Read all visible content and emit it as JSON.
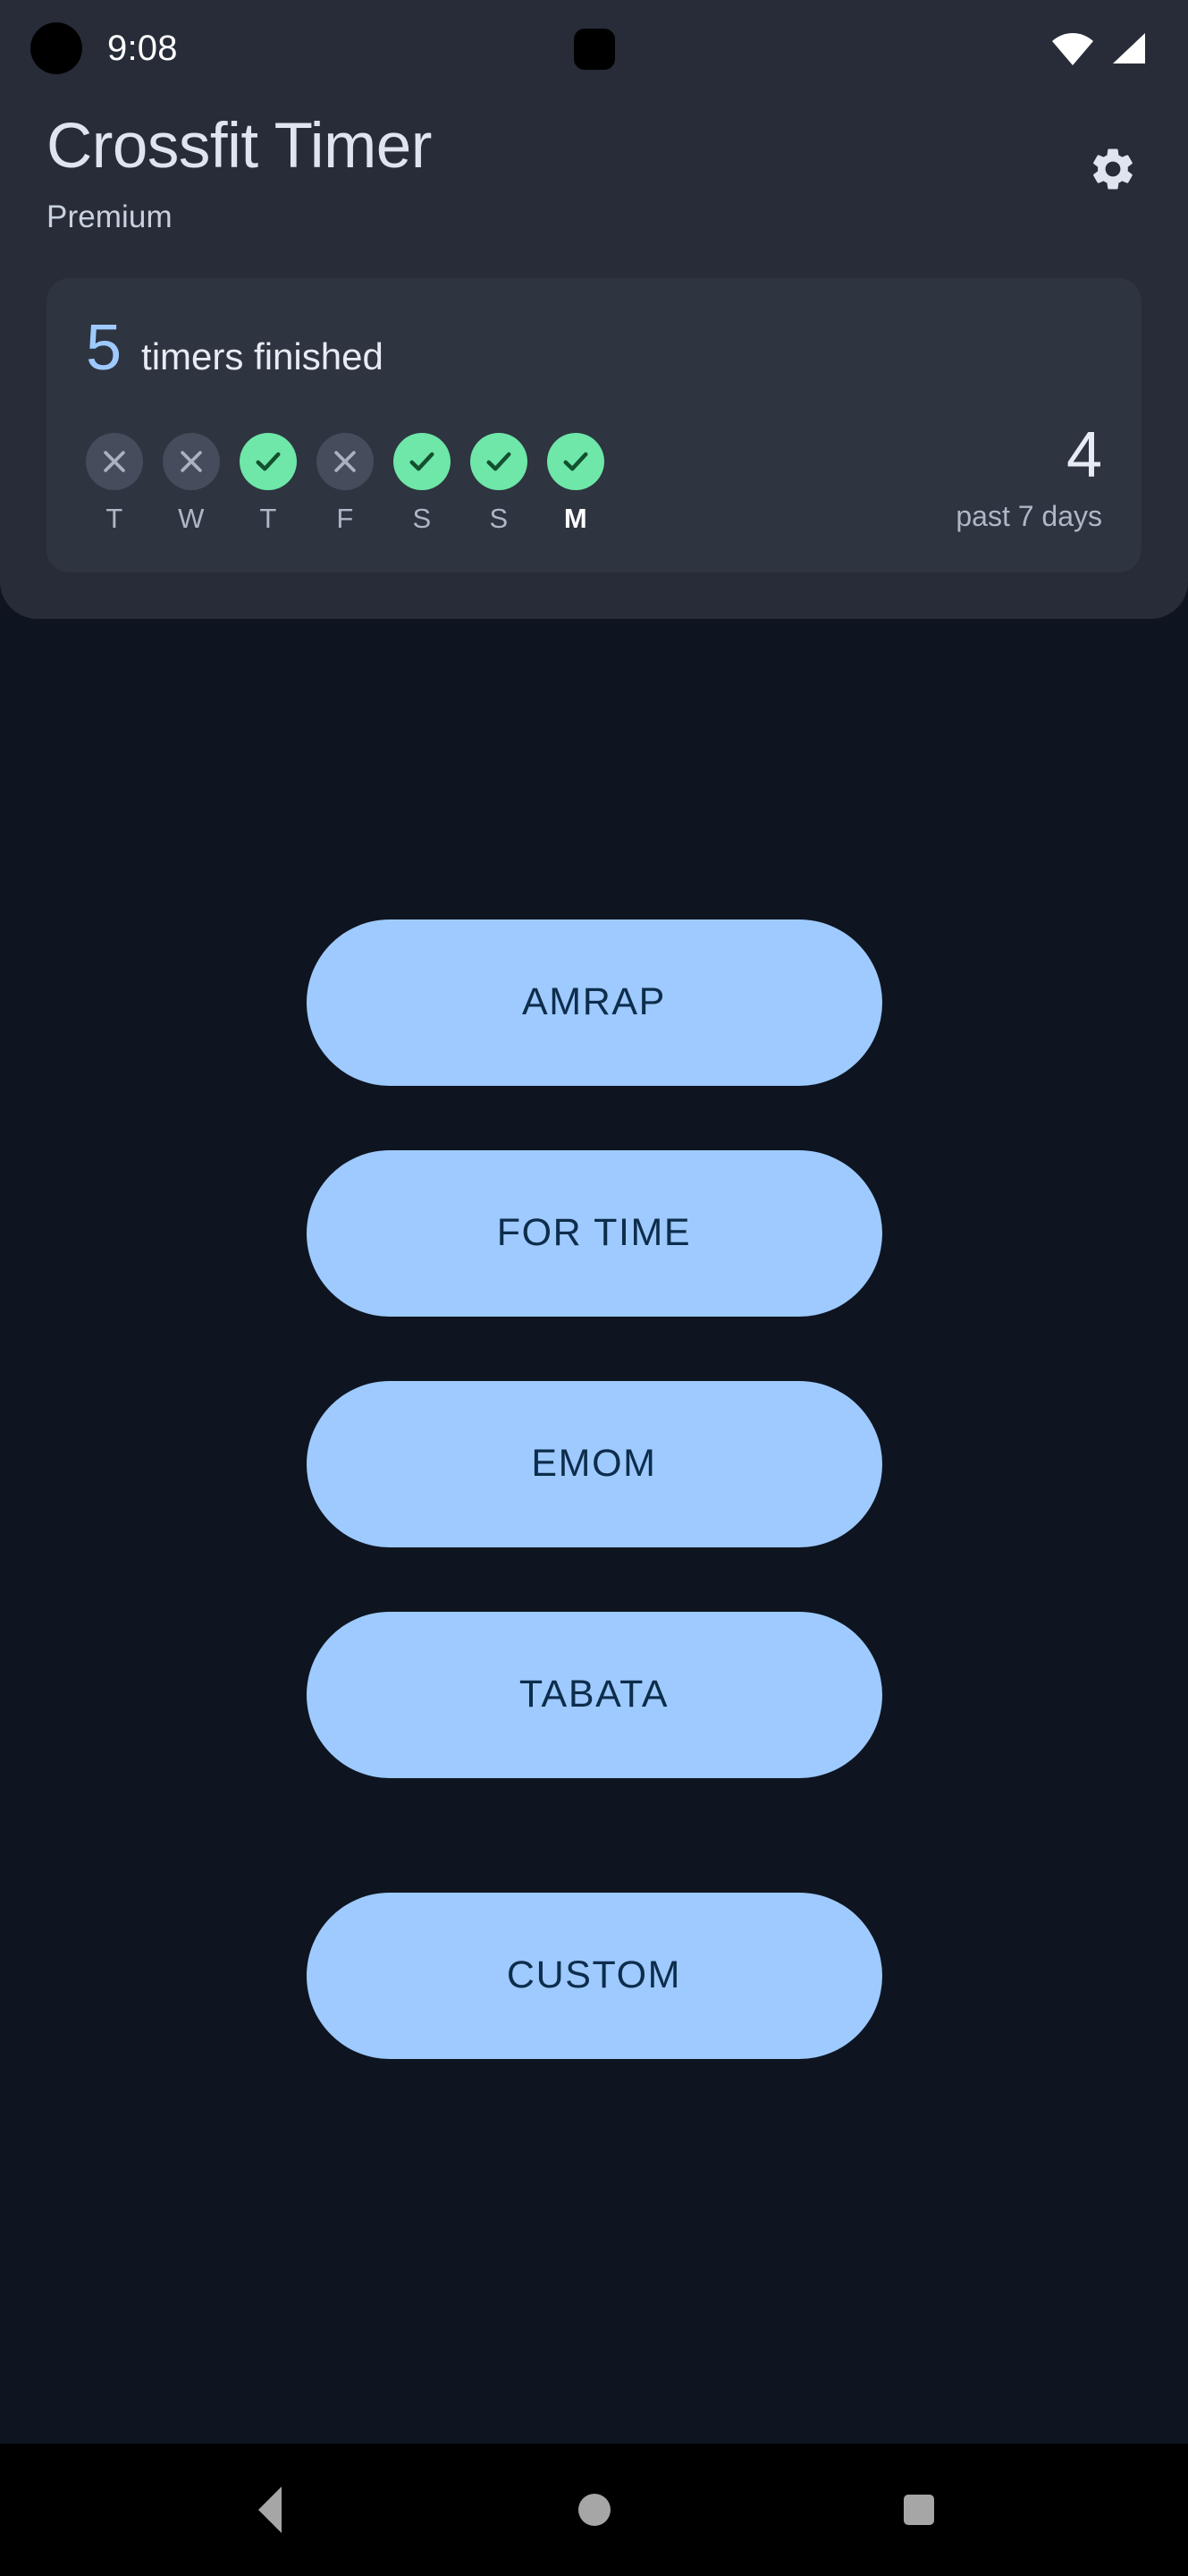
{
  "status_bar": {
    "time": "9:08",
    "wifi_icon": "wifi-icon",
    "signal_icon": "cellular-signal-icon",
    "camera_icon": "front-camera-dot"
  },
  "header": {
    "title": "Crossfit Timer",
    "subtitle": "Premium",
    "settings_icon": "gear-icon"
  },
  "stats_card": {
    "count": "5",
    "label": "timers finished",
    "week_count": "4",
    "week_caption": "past 7 days",
    "days": [
      {
        "label": "T",
        "status": "missed",
        "glyph": "✕",
        "today": false
      },
      {
        "label": "W",
        "status": "missed",
        "glyph": "✕",
        "today": false
      },
      {
        "label": "T",
        "status": "done",
        "glyph": "✓",
        "today": false
      },
      {
        "label": "F",
        "status": "missed",
        "glyph": "✕",
        "today": false
      },
      {
        "label": "S",
        "status": "done",
        "glyph": "✓",
        "today": false
      },
      {
        "label": "S",
        "status": "done",
        "glyph": "✓",
        "today": false
      },
      {
        "label": "M",
        "status": "done",
        "glyph": "✓",
        "today": true
      }
    ]
  },
  "timers": [
    {
      "label": "AMRAP",
      "extra_gap": false
    },
    {
      "label": "FOR TIME",
      "extra_gap": false
    },
    {
      "label": "EMOM",
      "extra_gap": false
    },
    {
      "label": "TABATA",
      "extra_gap": false
    },
    {
      "label": "CUSTOM",
      "extra_gap": true
    }
  ],
  "nav_bar": {
    "back": "back-icon",
    "home": "home-icon",
    "recents": "recents-icon"
  },
  "colors": {
    "background": "#0e1520",
    "header_panel": "#272c38",
    "card": "#2e3440",
    "accent_blue": "#9ecaff",
    "accent_blue_text": "#0d2d4b",
    "success_green": "#6ee7a8",
    "check_dark": "#13502f",
    "missed_circle": "#454c5c",
    "text_primary": "#dfe4ee",
    "text_secondary": "#aeb7c6"
  }
}
